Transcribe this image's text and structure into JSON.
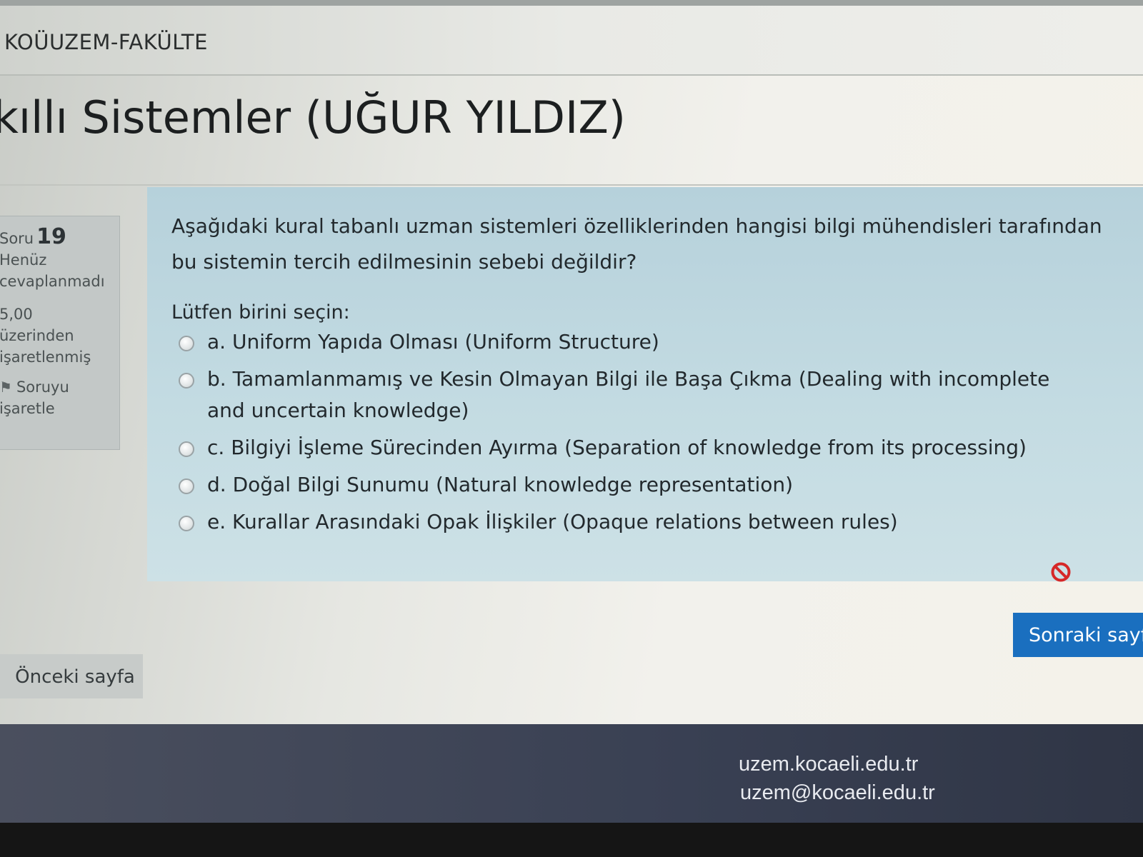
{
  "header": {
    "site_name": "KOÜUZEM-FAKÜLTE"
  },
  "course": {
    "title": "kıllı Sistemler (UĞUR YILDIZ)"
  },
  "question_info": {
    "label": "Soru",
    "number": "19",
    "status_line1": "Henüz",
    "status_line2": "cevaplanmadı",
    "score_line1": "5,00",
    "score_line2": "üzerinden",
    "score_line3": "işaretlenmiş",
    "flag_line1": "Soruyu",
    "flag_line2": "işaretle"
  },
  "question": {
    "text": "Aşağıdaki kural tabanlı uzman sistemleri özelliklerinden hangisi bilgi mühendisleri tarafından bu sistemin tercih edilmesinin sebebi değildir?",
    "prompt": "Lütfen birini seçin:",
    "answers": [
      {
        "label": "a. Uniform Yapıda Olması (Uniform Structure)"
      },
      {
        "label": "b. Tamamlanmamış ve Kesin Olmayan Bilgi ile Başa Çıkma (Dealing with incomplete and uncertain knowledge)"
      },
      {
        "label": "c. Bilgiyi İşleme Sürecinden Ayırma (Separation of knowledge from its processing)"
      },
      {
        "label": "d. Doğal Bilgi Sunumu (Natural knowledge representation)"
      },
      {
        "label": "e. Kurallar Arasındaki Opak İlişkiler (Opaque relations between rules)"
      }
    ]
  },
  "navigation": {
    "prev_label": "Önceki sayfa",
    "next_label": "Sonraki sayf"
  },
  "footer": {
    "website": "uzem.kocaeli.edu.tr",
    "email": "uzem@kocaeli.edu.tr"
  },
  "colors": {
    "question_bg": "#c3dbe2",
    "next_button": "#1a6fbf",
    "footer_bg": "#394053",
    "clear_icon": "#d62828"
  },
  "icons": {
    "flag": "flag-icon",
    "clear": "no-entry-icon",
    "radio": "radio-button"
  }
}
